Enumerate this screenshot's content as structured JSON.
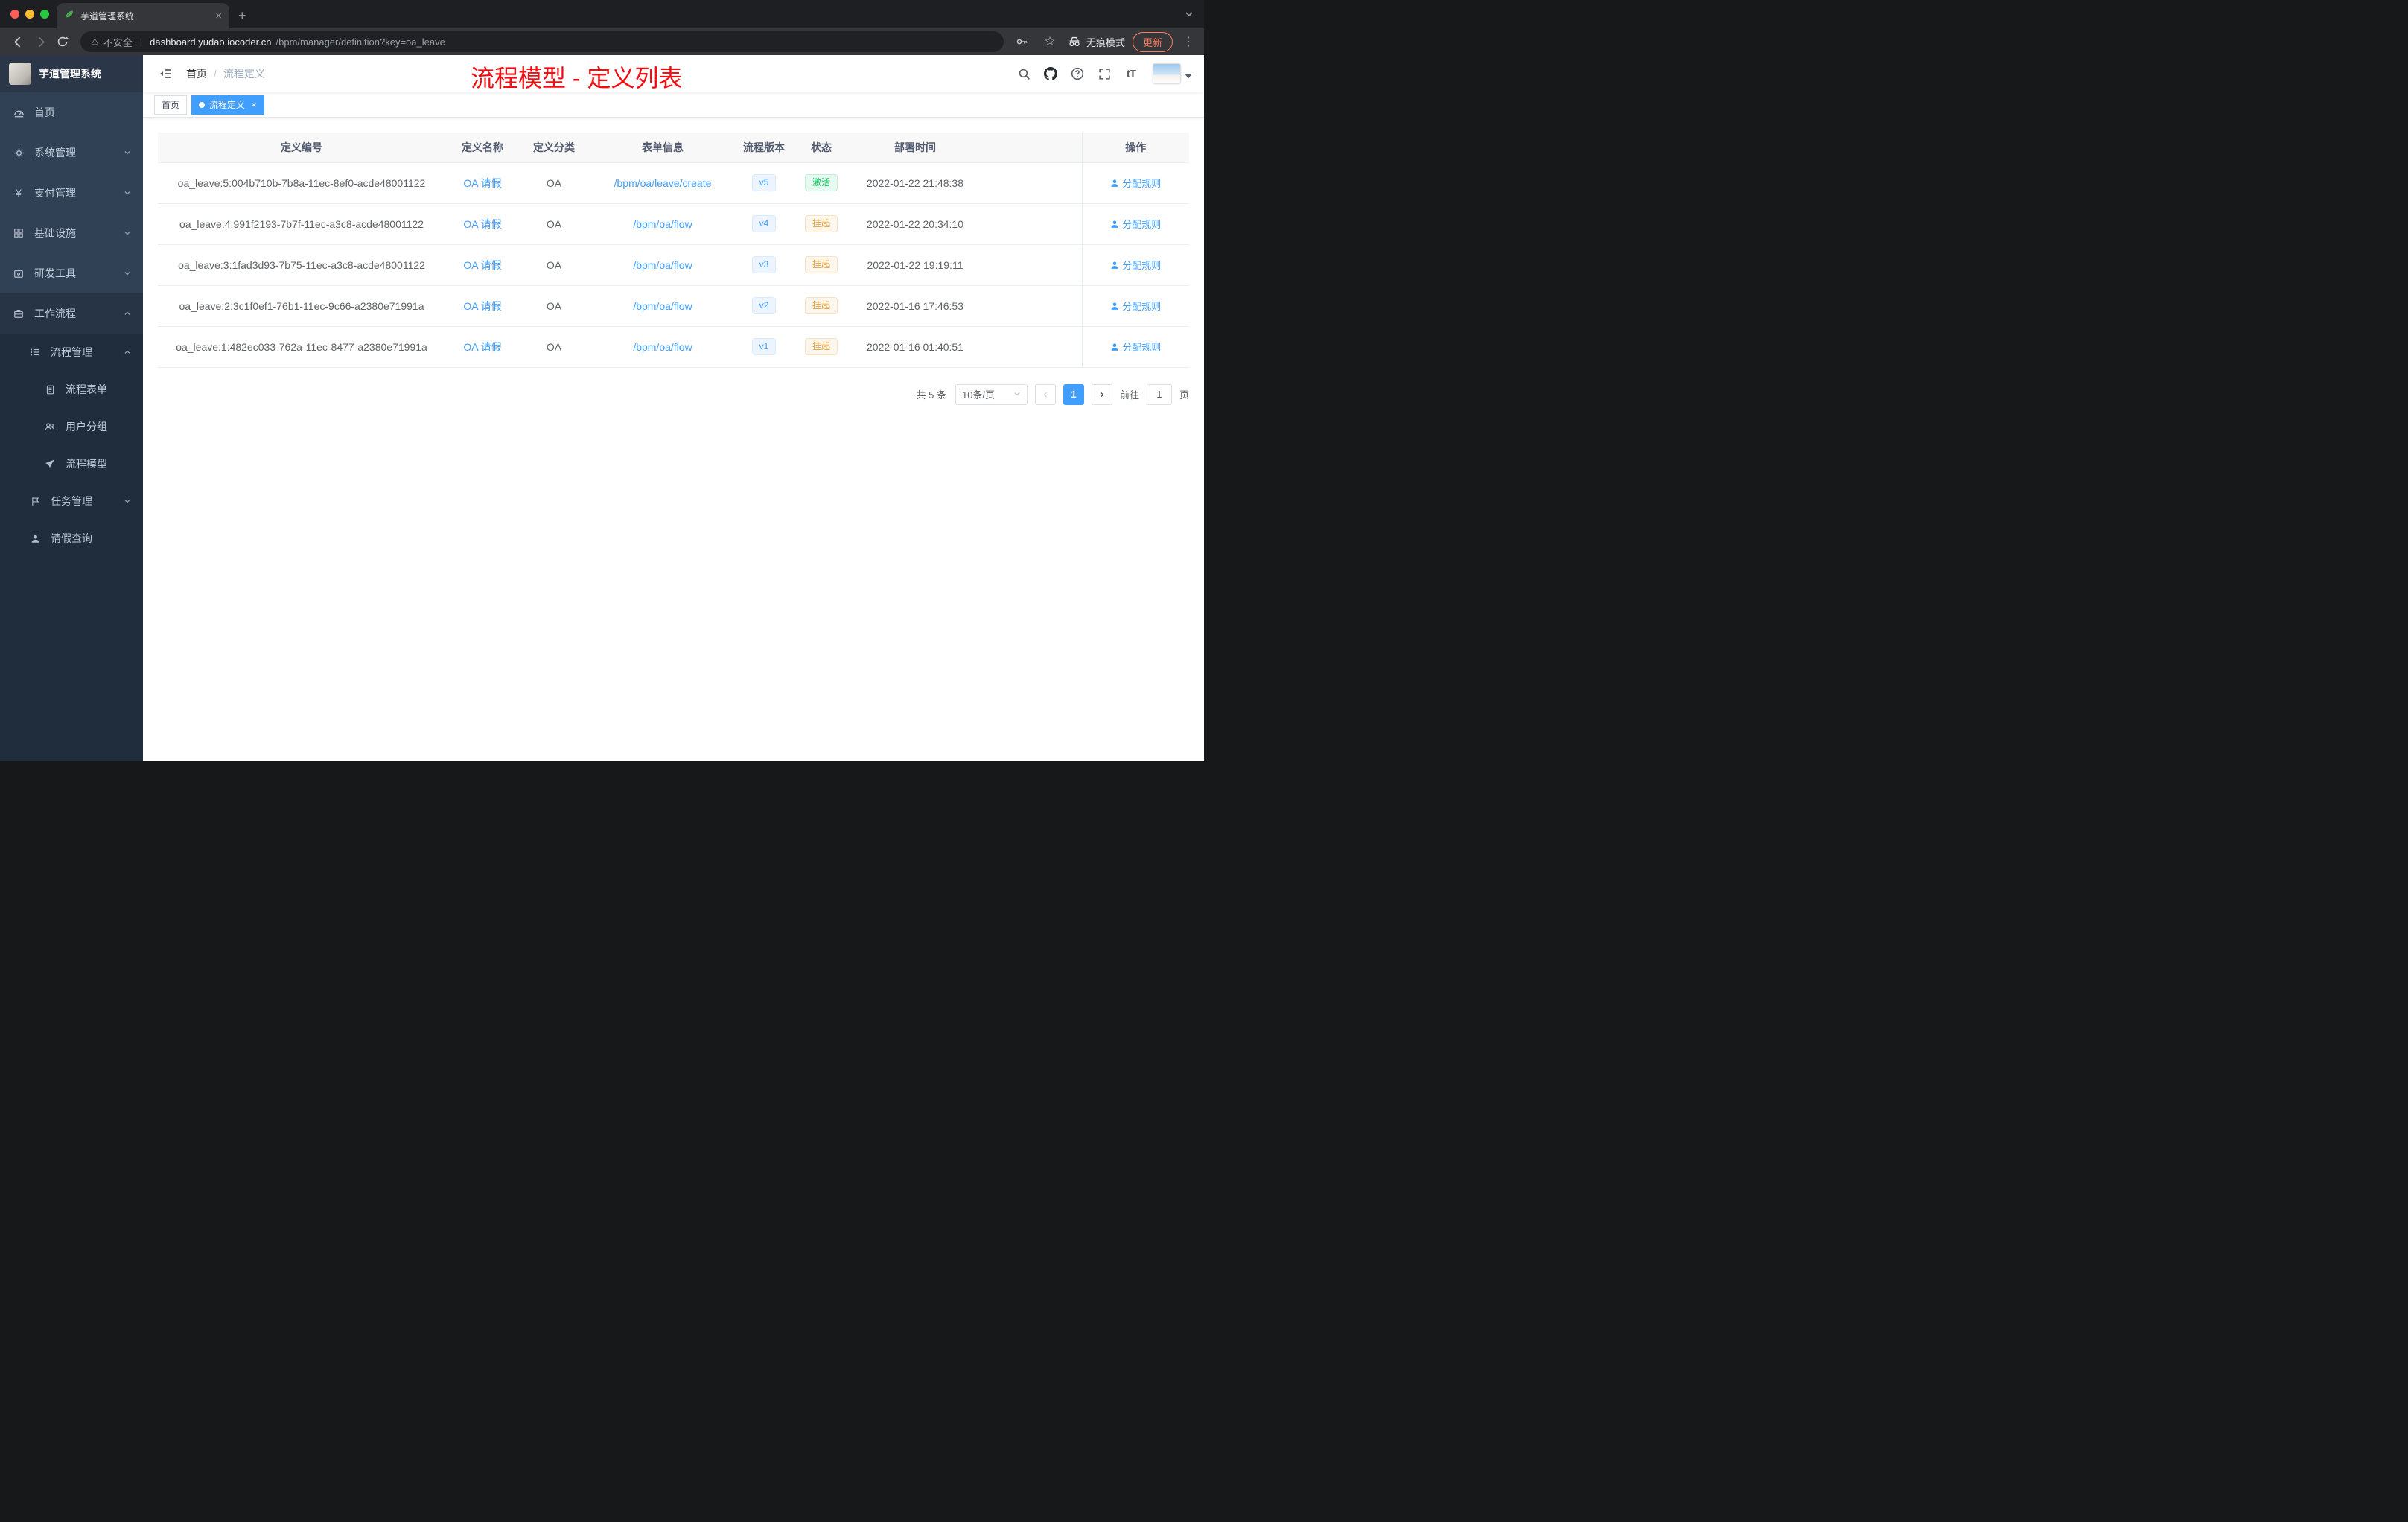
{
  "icons": {
    "close": "×",
    "plus": "+",
    "kebab": "⋮",
    "star": "☆",
    "warning": "⚠",
    "prev": "‹",
    "next": "›",
    "yen": "¥",
    "font_size": "tT",
    "slash": "/",
    "url_sep": "|"
  },
  "browser": {
    "tab_title": "芋道管理系统",
    "address": {
      "warning_label": "不安全",
      "host": "dashboard.yudao.iocoder.cn",
      "path": "/bpm/manager/definition?key=oa_leave"
    },
    "incognito_label": "无痕模式",
    "update_label": "更新"
  },
  "sidebar": {
    "logo_title": "芋道管理系统",
    "items": [
      {
        "label": "首页"
      },
      {
        "label": "系统管理"
      },
      {
        "label": "支付管理"
      },
      {
        "label": "基础设施"
      },
      {
        "label": "研发工具"
      },
      {
        "label": "工作流程"
      },
      {
        "label": "流程管理"
      },
      {
        "label": "流程表单"
      },
      {
        "label": "用户分组"
      },
      {
        "label": "流程模型"
      },
      {
        "label": "任务管理"
      },
      {
        "label": "请假查询"
      }
    ]
  },
  "navbar": {
    "breadcrumb": {
      "home": "首页",
      "current": "流程定义"
    }
  },
  "annotation": "流程模型 - 定义列表",
  "tags": {
    "home": "首页",
    "active": "流程定义"
  },
  "table": {
    "headers": [
      "定义编号",
      "定义名称",
      "定义分类",
      "表单信息",
      "流程版本",
      "状态",
      "部署时间",
      "操作"
    ],
    "action_label": "分配规则",
    "rows": [
      {
        "id": "oa_leave:5:004b710b-7b8a-11ec-8ef0-acde48001122",
        "name": "OA 请假",
        "category": "OA",
        "form": "/bpm/oa/leave/create",
        "version": "v5",
        "status": "激活",
        "time": "2022-01-22 21:48:38"
      },
      {
        "id": "oa_leave:4:991f2193-7b7f-11ec-a3c8-acde48001122",
        "name": "OA 请假",
        "category": "OA",
        "form": "/bpm/oa/flow",
        "version": "v4",
        "status": "挂起",
        "time": "2022-01-22 20:34:10"
      },
      {
        "id": "oa_leave:3:1fad3d93-7b75-11ec-a3c8-acde48001122",
        "name": "OA 请假",
        "category": "OA",
        "form": "/bpm/oa/flow",
        "version": "v3",
        "status": "挂起",
        "time": "2022-01-22 19:19:11"
      },
      {
        "id": "oa_leave:2:3c1f0ef1-76b1-11ec-9c66-a2380e71991a",
        "name": "OA 请假",
        "category": "OA",
        "form": "/bpm/oa/flow",
        "version": "v2",
        "status": "挂起",
        "time": "2022-01-16 17:46:53"
      },
      {
        "id": "oa_leave:1:482ec033-762a-11ec-8477-a2380e71991a",
        "name": "OA 请假",
        "category": "OA",
        "form": "/bpm/oa/flow",
        "version": "v1",
        "status": "挂起",
        "time": "2022-01-16 01:40:51"
      }
    ]
  },
  "pagination": {
    "total": "共 5 条",
    "page_size": "10条/页",
    "current_page": "1",
    "goto_label": "前往",
    "goto_value": "1",
    "goto_suffix": "页"
  },
  "colors": {
    "accent_blue": "#409eff",
    "success_green": "#13ce66",
    "warning_orange": "#e6a23c",
    "sidebar_dark": "#304156",
    "annotation_red": "#f20d11"
  }
}
